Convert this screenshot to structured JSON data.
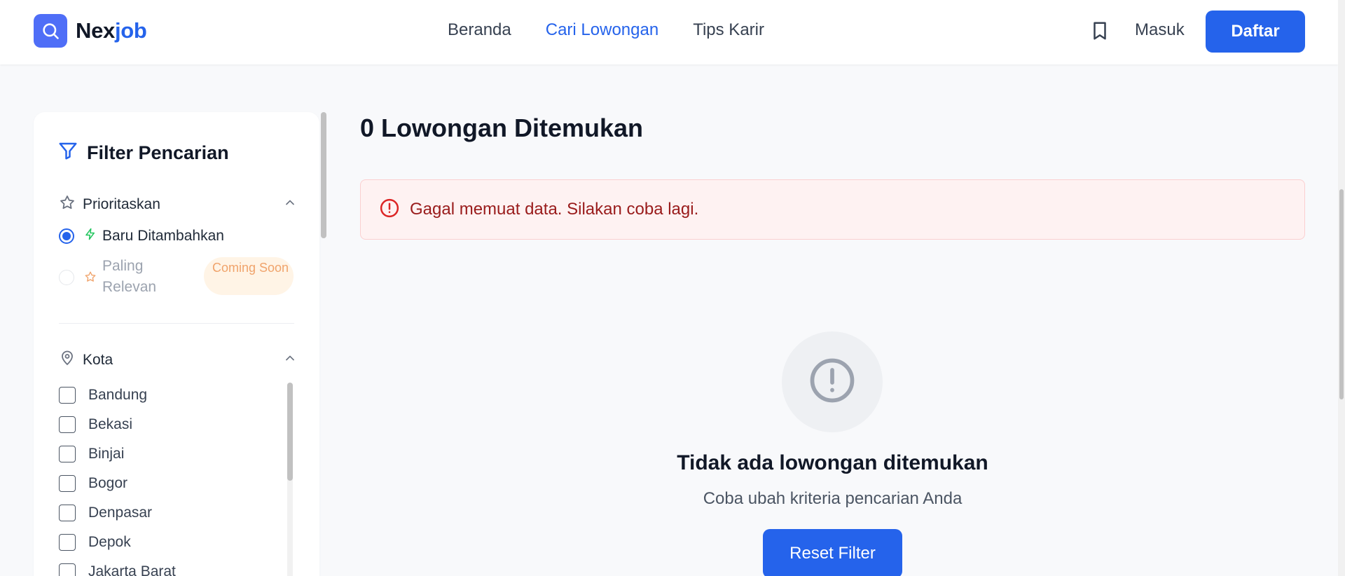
{
  "brand": {
    "name_part1": "Nex",
    "name_part2": "job"
  },
  "nav": {
    "items": [
      "Beranda",
      "Cari Lowongan",
      "Tips Karir"
    ],
    "active_index": 1
  },
  "header": {
    "login_label": "Masuk",
    "register_label": "Daftar"
  },
  "sidebar": {
    "title": "Filter Pencarian",
    "priority": {
      "label": "Prioritaskan",
      "options": [
        {
          "label": "Baru Ditambahkan",
          "selected": true
        },
        {
          "label": "Paling Relevan",
          "selected": false,
          "disabled": true,
          "badge": "Coming Soon"
        }
      ]
    },
    "city": {
      "label": "Kota",
      "options": [
        "Bandung",
        "Bekasi",
        "Binjai",
        "Bogor",
        "Denpasar",
        "Depok",
        "Jakarta Barat"
      ]
    }
  },
  "main": {
    "results_title": "0 Lowongan Ditemukan",
    "error_message": "Gagal memuat data. Silakan coba lagi.",
    "empty_title": "Tidak ada lowongan ditemukan",
    "empty_subtitle": "Coba ubah kriteria pencarian Anda",
    "reset_label": "Reset Filter"
  },
  "colors": {
    "primary": "#2563eb",
    "error_bg": "#fef2f2",
    "error_text": "#991b1b",
    "coming_soon": "#f0a36b",
    "bolt": "#22c55e"
  },
  "icons": [
    "search-icon",
    "bookmark-icon",
    "filter-icon",
    "star-icon",
    "chevron-up-icon",
    "bolt-icon",
    "map-pin-icon",
    "alert-circle-icon"
  ]
}
